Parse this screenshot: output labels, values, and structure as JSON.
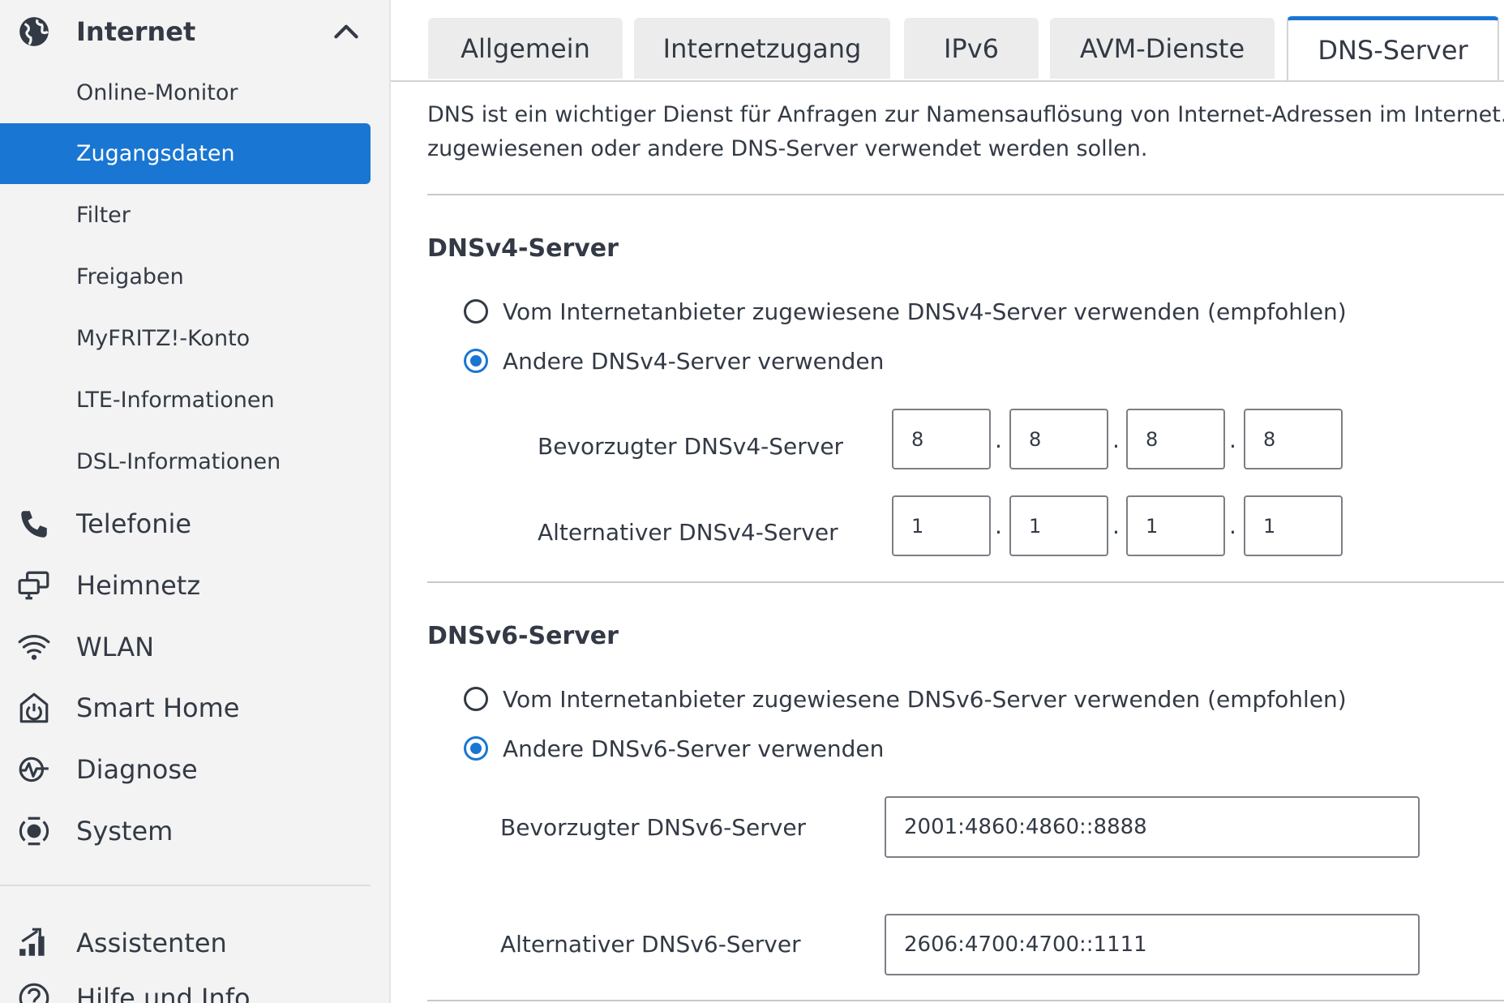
{
  "sidebar": {
    "items": [
      {
        "label": "Internet",
        "icon": "globe-icon",
        "expanded": true
      },
      {
        "label": "Telefonie",
        "icon": "phone-icon"
      },
      {
        "label": "Heimnetz",
        "icon": "network-icon"
      },
      {
        "label": "WLAN",
        "icon": "wifi-icon"
      },
      {
        "label": "Smart Home",
        "icon": "smart-home-icon"
      },
      {
        "label": "Diagnose",
        "icon": "diagnose-icon"
      },
      {
        "label": "System",
        "icon": "system-icon"
      },
      {
        "label": "Assistenten",
        "icon": "assistant-icon"
      },
      {
        "label": "Hilfe und Info",
        "icon": "help-icon"
      }
    ],
    "subitems": [
      {
        "label": "Online-Monitor"
      },
      {
        "label": "Zugangsdaten",
        "active": true
      },
      {
        "label": "Filter"
      },
      {
        "label": "Freigaben"
      },
      {
        "label": "MyFRITZ!-Konto"
      },
      {
        "label": "LTE-Informationen"
      },
      {
        "label": "DSL-Informationen"
      }
    ]
  },
  "tabs": [
    {
      "label": "Allgemein"
    },
    {
      "label": "Internetzugang"
    },
    {
      "label": "IPv6"
    },
    {
      "label": "AVM-Dienste"
    },
    {
      "label": "DNS-Server",
      "active": true
    }
  ],
  "description": {
    "line1": "DNS ist ein wichtiger Dienst für Anfragen zur Namensauflösung von Internet-Adressen im Internet. Hier",
    "line2": "zugewiesenen oder andere DNS-Server verwendet werden sollen."
  },
  "dnsv4": {
    "title": "DNSv4-Server",
    "option_provider": "Vom Internetanbieter zugewiesene DNSv4-Server verwenden (empfohlen)",
    "option_custom": "Andere DNSv4-Server verwenden",
    "selected": "custom",
    "preferred_label": "Bevorzugter DNSv4-Server",
    "preferred": [
      "8",
      "8",
      "8",
      "8"
    ],
    "alternative_label": "Alternativer DNSv4-Server",
    "alternative": [
      "1",
      "1",
      "1",
      "1"
    ],
    "separator": "."
  },
  "dnsv6": {
    "title": "DNSv6-Server",
    "option_provider": "Vom Internetanbieter zugewiesene DNSv6-Server verwenden (empfohlen)",
    "option_custom": "Andere DNSv6-Server verwenden",
    "selected": "custom",
    "preferred_label": "Bevorzugter DNSv6-Server",
    "preferred": "2001:4860:4860::8888",
    "alternative_label": "Alternativer DNSv6-Server",
    "alternative": "2606:4700:4700::1111"
  },
  "colors": {
    "accent": "#1976d2",
    "sidebar_bg": "#f3f3f3",
    "text": "#333a45"
  }
}
